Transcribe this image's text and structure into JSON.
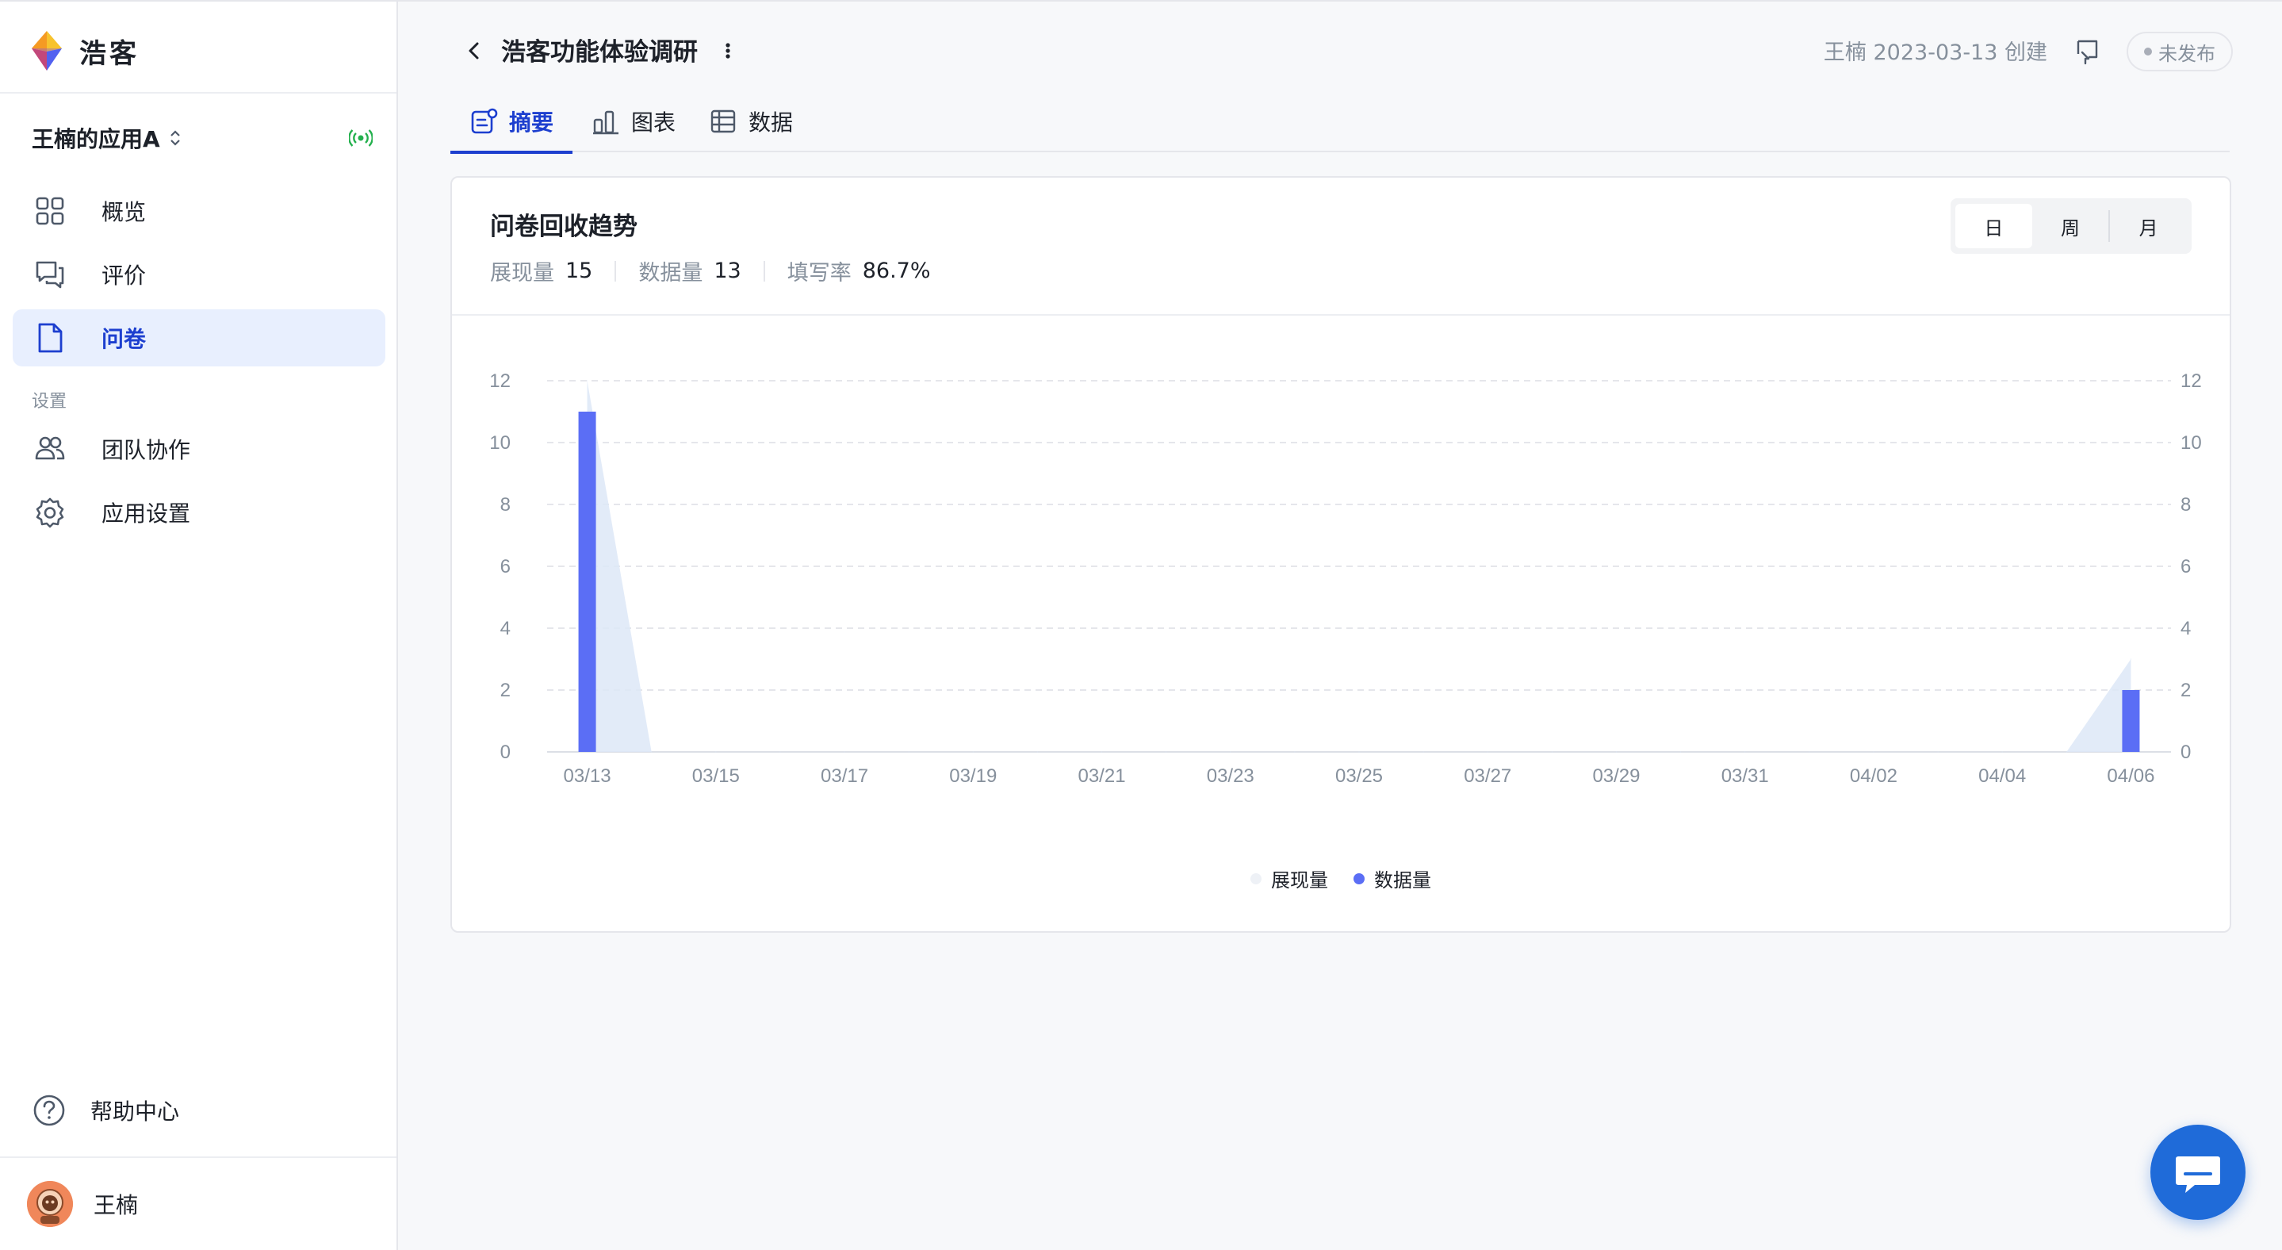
{
  "brand": {
    "name": "浩客"
  },
  "app": {
    "name": "王楠的应用A"
  },
  "nav": {
    "items": [
      {
        "label": "概览",
        "icon": "grid-icon"
      },
      {
        "label": "评价",
        "icon": "chat-icon"
      },
      {
        "label": "问卷",
        "icon": "document-icon",
        "active": true
      }
    ],
    "settings_label": "设置",
    "settings_items": [
      {
        "label": "团队协作",
        "icon": "users-icon"
      },
      {
        "label": "应用设置",
        "icon": "gear-icon"
      }
    ],
    "help_label": "帮助中心"
  },
  "user": {
    "name": "王楠"
  },
  "header": {
    "title": "浩客功能体验调研",
    "creator": "王楠 2023-03-13 创建",
    "status": "未发布"
  },
  "tabs": [
    {
      "label": "摘要",
      "active": true
    },
    {
      "label": "图表"
    },
    {
      "label": "数据"
    }
  ],
  "card": {
    "title": "问卷回收趋势",
    "stats": [
      {
        "label": "展现量",
        "value": "15"
      },
      {
        "label": "数据量",
        "value": "13"
      },
      {
        "label": "填写率",
        "value": "86.7%"
      }
    ],
    "granularity": {
      "options": [
        "日",
        "周",
        "月"
      ],
      "selected": "日"
    }
  },
  "colors": {
    "accent": "#1d3fcf",
    "bar": "#5b6ef5",
    "area": "#dde8f7"
  },
  "chart_data": {
    "type": "bar",
    "x": [
      "03/13",
      "03/14",
      "03/15",
      "03/16",
      "03/17",
      "03/18",
      "03/19",
      "03/20",
      "03/21",
      "03/22",
      "03/23",
      "03/24",
      "03/25",
      "03/26",
      "03/27",
      "03/28",
      "03/29",
      "03/30",
      "03/31",
      "04/01",
      "04/02",
      "04/03",
      "04/04",
      "04/05",
      "04/06"
    ],
    "tick_labels": [
      "03/13",
      "03/15",
      "03/17",
      "03/19",
      "03/21",
      "03/23",
      "03/25",
      "03/27",
      "03/29",
      "03/31",
      "04/02",
      "04/04",
      "04/06"
    ],
    "series": [
      {
        "name": "展现量",
        "type": "area",
        "values": [
          12,
          0,
          0,
          0,
          0,
          0,
          0,
          0,
          0,
          0,
          0,
          0,
          0,
          0,
          0,
          0,
          0,
          0,
          0,
          0,
          0,
          0,
          0,
          0,
          3
        ]
      },
      {
        "name": "数据量",
        "type": "bar",
        "values": [
          11,
          0,
          0,
          0,
          0,
          0,
          0,
          0,
          0,
          0,
          0,
          0,
          0,
          0,
          0,
          0,
          0,
          0,
          0,
          0,
          0,
          0,
          0,
          0,
          2
        ]
      }
    ],
    "y_ticks": [
      0,
      2,
      4,
      6,
      8,
      10,
      12
    ],
    "ylim": [
      0,
      12
    ],
    "dual_axis": true,
    "grid": true,
    "legend": "bottom-center"
  }
}
